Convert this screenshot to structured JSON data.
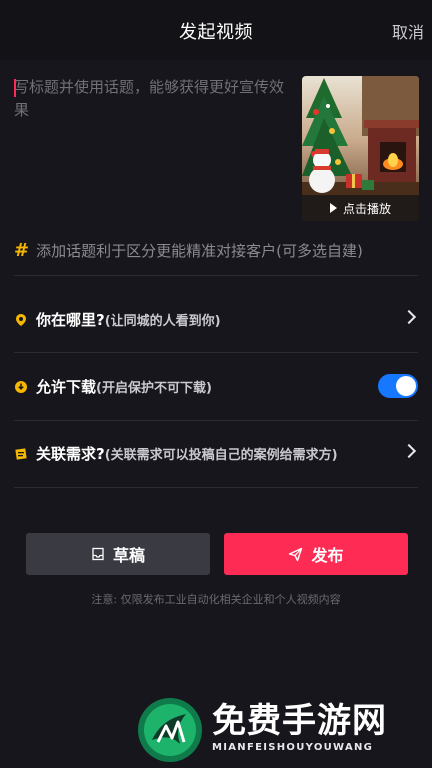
{
  "header": {
    "title": "发起视频",
    "cancel_label": "取消"
  },
  "description": {
    "placeholder": "写标题并使用话题，能够获得更好宣传效果"
  },
  "cover": {
    "play_label": "点击播放"
  },
  "topic": {
    "placeholder": "添加话题利于区分更能精准对接客户(可多选自建)"
  },
  "rows": [
    {
      "label": "你在哪里?",
      "hint": "(让同城的人看到你)",
      "icon": "location-pin-icon"
    },
    {
      "label": "允许下载",
      "hint": "(开启保护不可下载)",
      "icon": "download-icon",
      "toggle_on": true
    },
    {
      "label": "关联需求?",
      "hint": "(关联需求可以投稿自己的案例给需求方)",
      "icon": "note-icon"
    }
  ],
  "buttons": {
    "draft_label": "草稿",
    "publish_label": "发布"
  },
  "note": "注意: 仅限发布工业自动化相关企业和个人视频内容",
  "watermark": {
    "title": "免费手游网",
    "subtitle": "MIANFEISHOUYOUWANG"
  },
  "colors": {
    "accent": "#fe2c55",
    "toggle": "#1677ff",
    "icon_yellow": "#f5b700"
  }
}
